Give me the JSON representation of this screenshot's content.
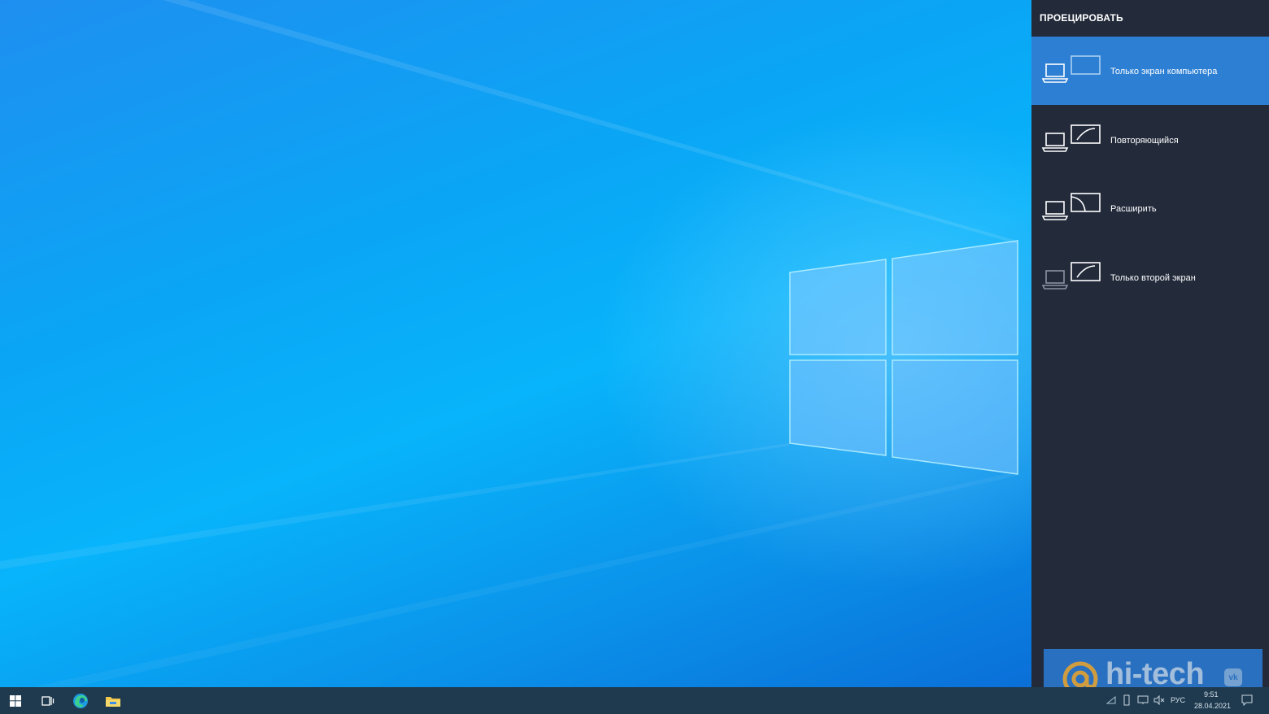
{
  "panel": {
    "title": "ПРОЕЦИРОВАТЬ",
    "options": [
      {
        "label": "Только экран компьютера",
        "icon": "pc-screen-only-icon",
        "selected": true
      },
      {
        "label": "Повторяющийся",
        "icon": "duplicate-icon",
        "selected": false
      },
      {
        "label": "Расширить",
        "icon": "extend-icon",
        "selected": false
      },
      {
        "label": "Только второй экран",
        "icon": "second-screen-only-icon",
        "selected": false
      }
    ]
  },
  "taskbar": {
    "icons": [
      "windows-start-icon",
      "task-view-icon",
      "edge-icon",
      "file-explorer-icon"
    ],
    "tray": {
      "language": "РУС",
      "time": "9:51",
      "date": "28.04.2021"
    }
  },
  "watermark": {
    "text": "hi-tech",
    "badge": "vk"
  },
  "colors": {
    "panel_bg": "#232b3b",
    "selected_bg": "#2d7fd3",
    "taskbar_bg": "#1f3a4f",
    "accent": "#0aa6f5"
  }
}
